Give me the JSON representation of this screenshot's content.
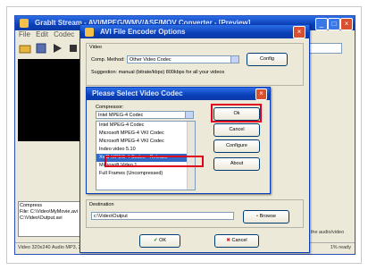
{
  "main_window": {
    "title": "GrabIt Stream - AVI/MPEG/WMV/ASF/MOV Converter - [Preview]",
    "menu": [
      "File",
      "Edit",
      "Codec"
    ],
    "log_lines": [
      "Compress",
      "File: C:\\Video\\MyMovie.avi",
      "C:\\Video\\Output.avi"
    ],
    "status": "Video 320x240 Audio MP3, 22050 Hz",
    "status_right": "1% ready",
    "right_label": "ing the audio/video"
  },
  "xvid_dialog": {
    "title": "AVI File Encoder Options",
    "video_group": "Video",
    "comp_method_label": "Comp. Method:",
    "comp_method_value": "Other Video Codec",
    "config_button": "Config",
    "suggestion": "Suggestion: manual (bitrate/kbps) 800kbps for all your videos",
    "destination_group": "Destination",
    "destination_value": "c:\\Video\\Output",
    "browse_button": "Browse",
    "ok_button": "OK",
    "cancel_button": "Cancel"
  },
  "codec_dialog": {
    "title": "Please Select Video Codec",
    "group_label": "Compressor:",
    "current_value": "Intel MPEG-4 Codec",
    "codecs": [
      "Intel MPEG-4 Codec",
      "Microsoft MPEG-4 VKI Codec",
      "Microsoft MPEG-4 VKI Codec",
      "Indeo video 5.10",
      "XviD MPEG-4 Codec - Release",
      "Microsoft Video 1",
      "Full Frames (Uncompressed)"
    ],
    "selected_index": 4,
    "ok_button": "Ok",
    "cancel_button": "Cancel",
    "configure_button": "Configure",
    "about_button": "About"
  },
  "highlight_color": "#e0001b",
  "selection_color": "#316ac5"
}
